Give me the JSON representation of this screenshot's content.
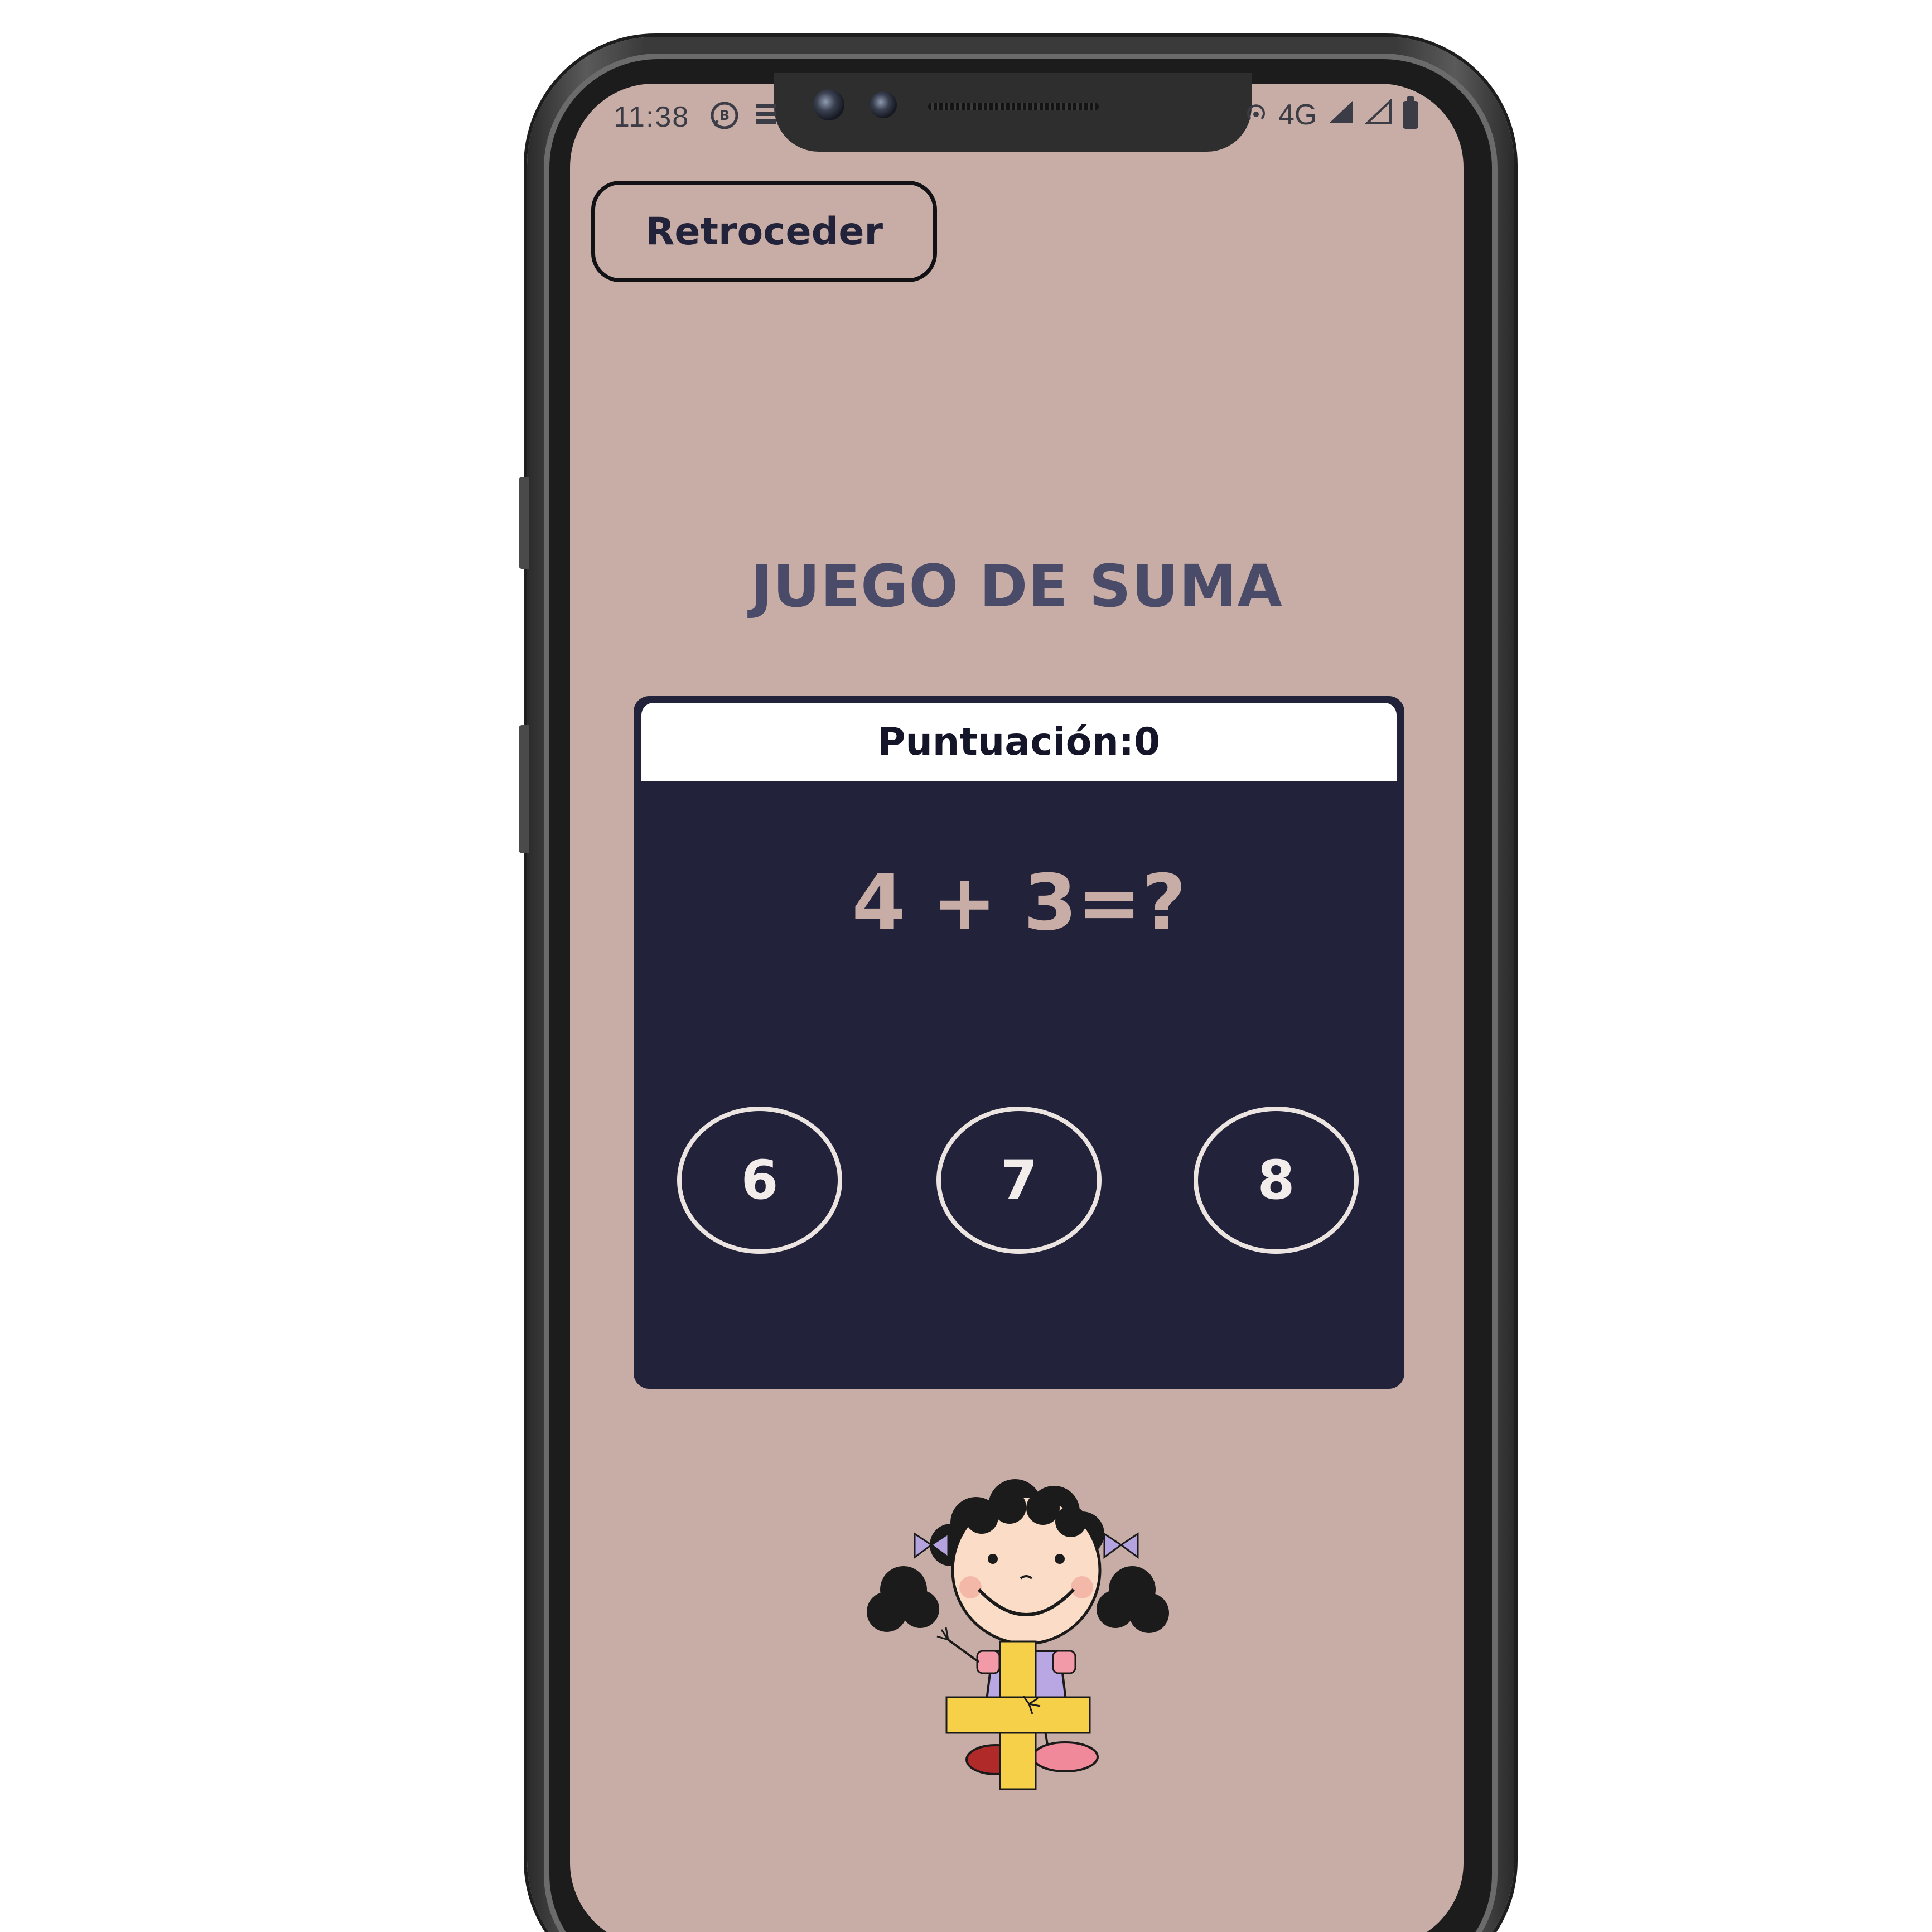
{
  "status_bar": {
    "time": "11:38",
    "network": "4G"
  },
  "nav": {
    "back_label": "Retroceder"
  },
  "game": {
    "title": "JUEGO DE SUMA",
    "score_label": "Puntuación:0",
    "question": "4 + 3=?",
    "options": [
      "6",
      "7",
      "8"
    ]
  },
  "colors": {
    "background": "#c8ada6",
    "card": "#22223a",
    "title": "#4a4b68",
    "plus_sign": "#f7d04a"
  },
  "icons": {
    "status_left": [
      "whatsapp-icon",
      "data-saver-icon"
    ],
    "status_right": [
      "hotspot-icon",
      "signal-icon",
      "signal-empty-icon",
      "battery-icon"
    ],
    "illustration": "girl-with-plus-sign-illustration"
  }
}
